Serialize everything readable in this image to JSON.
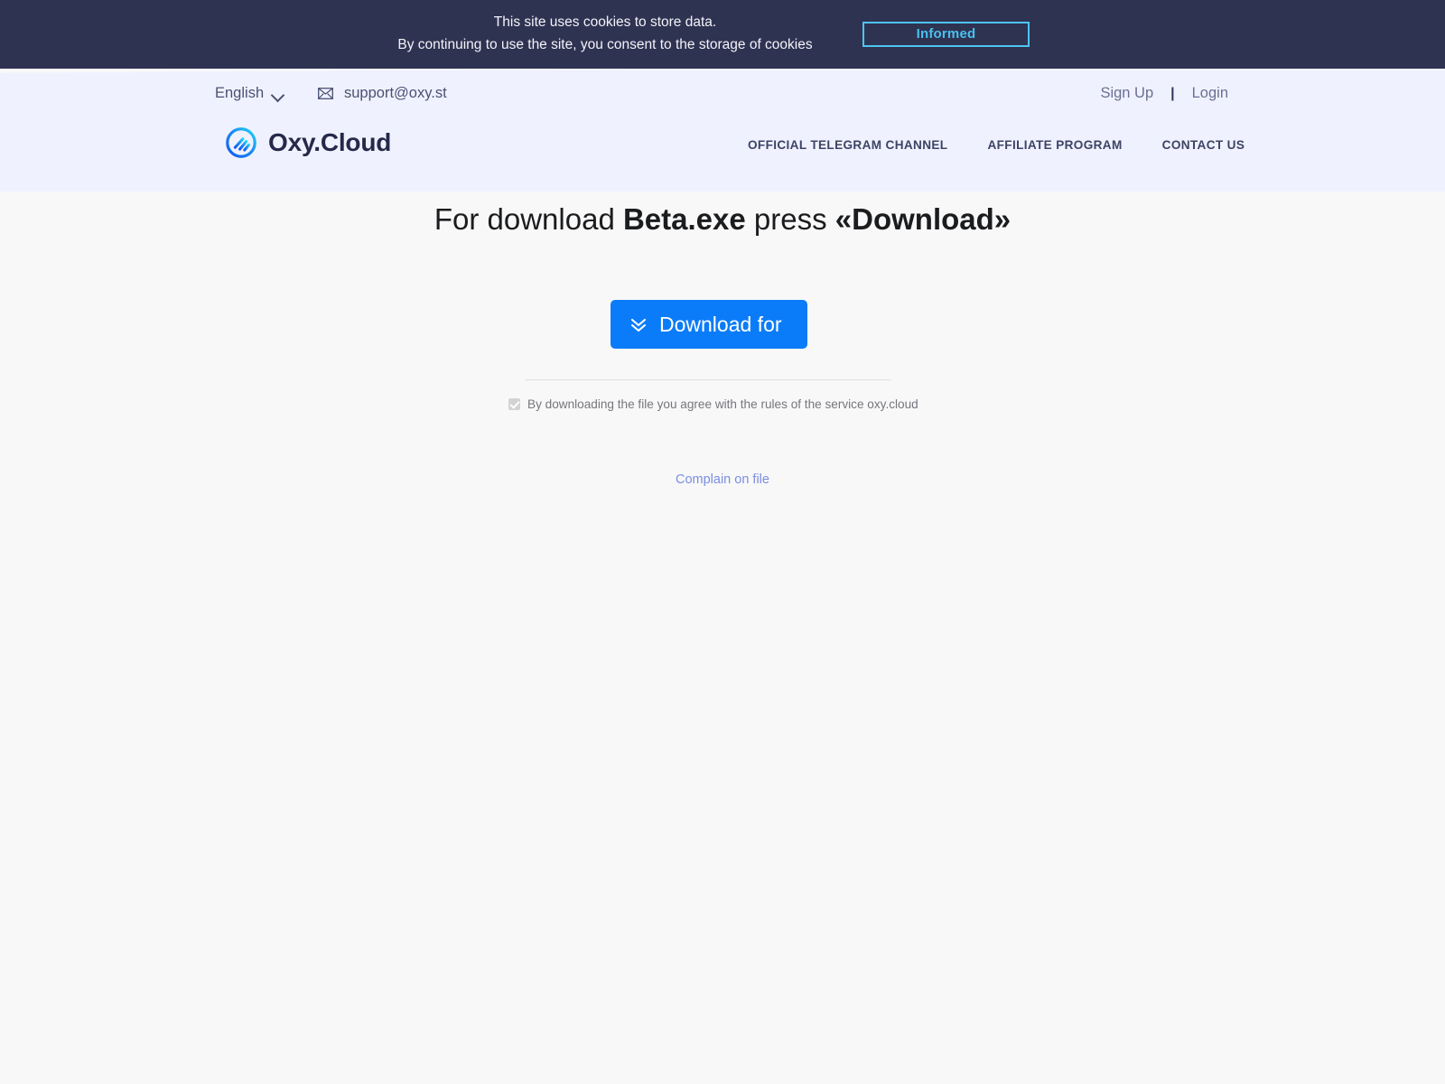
{
  "cookie_banner": {
    "line1": "This site uses cookies to store data.",
    "line2": "By continuing to use the site, you consent to the storage of cookies",
    "accept_label": "Informed",
    "background": "#2f3352",
    "accent": "#4ec5f0"
  },
  "header": {
    "language": "English",
    "support_email": "support@oxy.st",
    "sign_up": "Sign Up",
    "separator": "|",
    "login": "Login",
    "logo_text": "Oxy.Cloud",
    "background": "#eff2fe",
    "nav": [
      {
        "label": "OFFICIAL TELEGRAM CHANNEL"
      },
      {
        "label": "AFFILIATE PROGRAM"
      },
      {
        "label": "CONTACT US"
      }
    ]
  },
  "main": {
    "title_part1": "For download ",
    "title_filename": "Beta.exe",
    "title_part2": " press ",
    "title_action": "«Download»",
    "download_button": "Download for",
    "download_button_color": "#0b7cf9",
    "agree_text": "By downloading the file you agree with the rules of the service oxy.cloud",
    "agree_checked": true,
    "complain_link": "Complain on file",
    "link_color": "#7b8de0"
  }
}
